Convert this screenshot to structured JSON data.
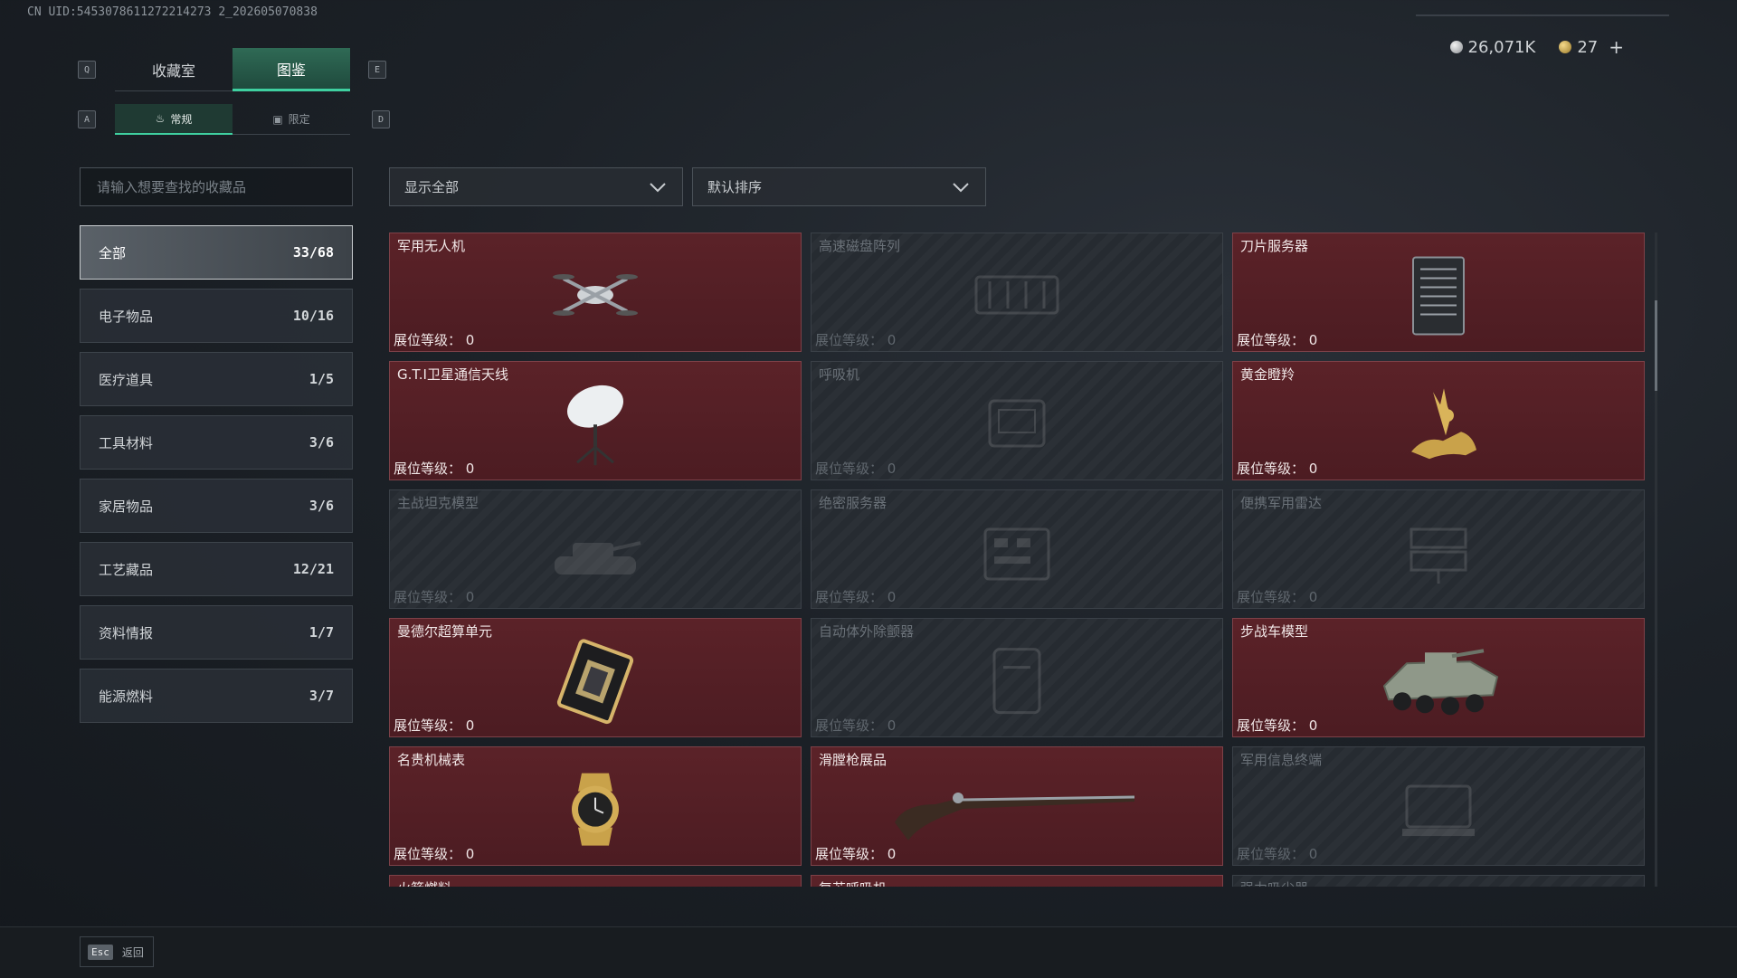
{
  "uid_text": "CN UID:5453078611272214273 2_202605070838",
  "currency": {
    "silver": "26,071K",
    "gold": "27"
  },
  "keys": {
    "q": "Q",
    "e": "E",
    "a": "A",
    "d": "D"
  },
  "tabs": [
    {
      "label": "收藏室"
    },
    {
      "label": "图鉴"
    }
  ],
  "subtabs": [
    {
      "label": "常规"
    },
    {
      "label": "限定"
    }
  ],
  "search": {
    "placeholder": "请输入想要查找的收藏品"
  },
  "categories": [
    {
      "label": "全部",
      "count": "33/68"
    },
    {
      "label": "电子物品",
      "count": "10/16"
    },
    {
      "label": "医疗道具",
      "count": "1/5"
    },
    {
      "label": "工具材料",
      "count": "3/6"
    },
    {
      "label": "家居物品",
      "count": "3/6"
    },
    {
      "label": "工艺藏品",
      "count": "12/21"
    },
    {
      "label": "资料情报",
      "count": "1/7"
    },
    {
      "label": "能源燃料",
      "count": "3/7"
    }
  ],
  "filters": {
    "show": "显示全部",
    "sort": "默认排序"
  },
  "level_label": "展位等级：",
  "items": [
    {
      "name": "军用无人机",
      "level": "0",
      "owned": true,
      "icon": "drone-icon"
    },
    {
      "name": "高速磁盘阵列",
      "level": "0",
      "owned": false,
      "icon": "disk-array-icon"
    },
    {
      "name": "刀片服务器",
      "level": "0",
      "owned": true,
      "icon": "server-icon"
    },
    {
      "name": "G.T.I卫星通信天线",
      "level": "0",
      "owned": true,
      "icon": "satellite-dish-icon"
    },
    {
      "name": "呼吸机",
      "level": "0",
      "owned": false,
      "icon": "ventilator-icon"
    },
    {
      "name": "黄金瞪羚",
      "level": "0",
      "owned": true,
      "icon": "gold-gazelle-icon"
    },
    {
      "name": "主战坦克模型",
      "level": "0",
      "owned": false,
      "icon": "tank-model-icon"
    },
    {
      "name": "绝密服务器",
      "level": "0",
      "owned": false,
      "icon": "secret-server-icon"
    },
    {
      "name": "便携军用雷达",
      "level": "0",
      "owned": false,
      "icon": "radar-icon"
    },
    {
      "name": "曼德尔超算单元",
      "level": "0",
      "owned": true,
      "icon": "supercomputer-chip-icon"
    },
    {
      "name": "自动体外除颤器",
      "level": "0",
      "owned": false,
      "icon": "defibrillator-icon"
    },
    {
      "name": "步战车模型",
      "level": "0",
      "owned": true,
      "icon": "ifv-model-icon"
    },
    {
      "name": "名贵机械表",
      "level": "0",
      "owned": true,
      "icon": "watch-icon"
    },
    {
      "name": "滑膛枪展品",
      "level": "0",
      "owned": true,
      "icon": "musket-icon"
    },
    {
      "name": "军用信息终端",
      "level": "0",
      "owned": false,
      "icon": "terminal-icon"
    },
    {
      "name": "火箭燃料",
      "level": "",
      "owned": true,
      "icon": ""
    },
    {
      "name": "复苏呼吸机",
      "level": "",
      "owned": true,
      "icon": ""
    },
    {
      "name": "强力吸尘器",
      "level": "",
      "owned": false,
      "icon": ""
    }
  ],
  "footer": {
    "key": "Esc",
    "label": "返回"
  }
}
